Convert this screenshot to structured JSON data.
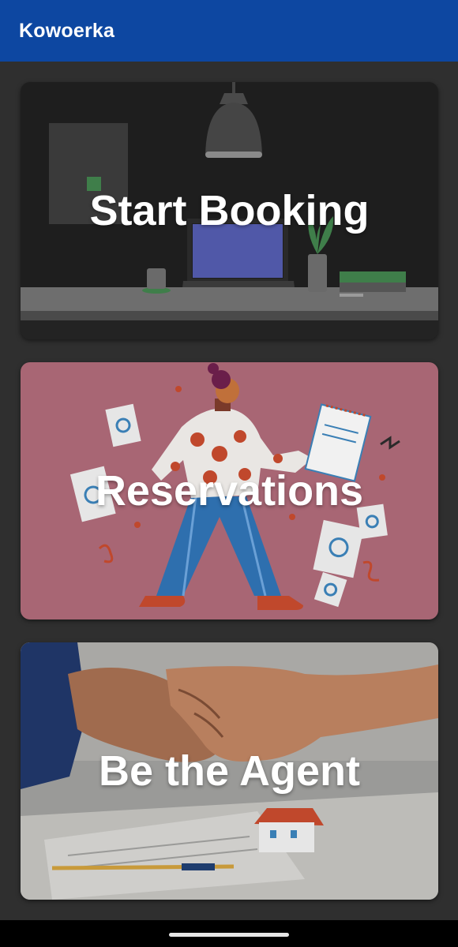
{
  "app_bar": {
    "title": "Kowoerka"
  },
  "cards": [
    {
      "label": "Start Booking"
    },
    {
      "label": "Reservations"
    },
    {
      "label": "Be the Agent"
    }
  ]
}
